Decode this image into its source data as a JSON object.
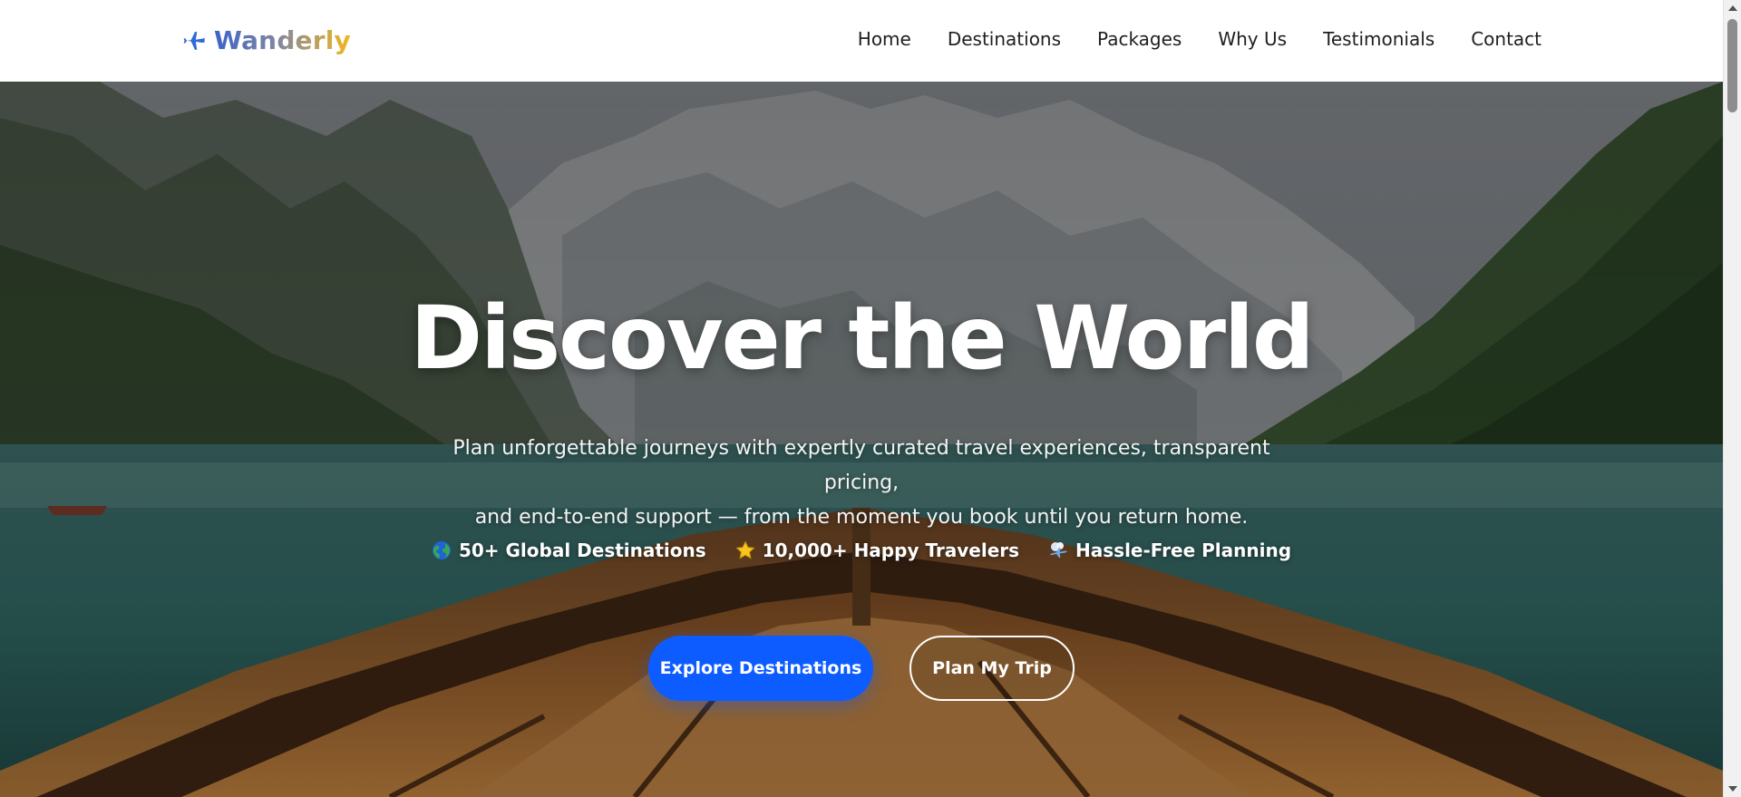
{
  "brand": {
    "name": "Wanderly",
    "icon": "airplane-icon",
    "gradient": [
      "#3b63c8",
      "#7f86a3",
      "#f0b81f"
    ]
  },
  "nav": {
    "links": [
      {
        "label": "Home"
      },
      {
        "label": "Destinations"
      },
      {
        "label": "Packages"
      },
      {
        "label": "Why Us"
      },
      {
        "label": "Testimonials"
      },
      {
        "label": "Contact"
      }
    ]
  },
  "hero": {
    "title": "Discover the World",
    "subtitle_line1": "Plan unforgettable journeys with expertly curated travel experiences, transparent pricing,",
    "subtitle_line2": "and end-to-end support — from the moment you book until you return home.",
    "features": [
      {
        "icon": "globe-icon",
        "label": "50+ Global Destinations"
      },
      {
        "icon": "star-icon",
        "label": "10,000+ Happy Travelers"
      },
      {
        "icon": "travel-planning-icon",
        "label": "Hassle-Free Planning"
      }
    ],
    "primary_cta": "Explore Destinations",
    "secondary_cta": "Plan My Trip"
  },
  "colors": {
    "primary_button": "#0d5cff",
    "nav_text": "#1f1f1f",
    "hero_text": "#ffffff"
  }
}
